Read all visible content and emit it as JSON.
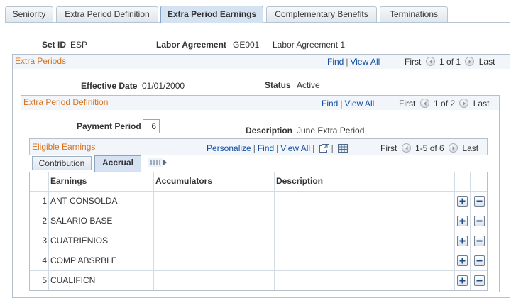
{
  "page_tabs": [
    {
      "label": "Seniority",
      "active": false
    },
    {
      "label": "Extra Period Definition",
      "active": false
    },
    {
      "label": "Extra Period Earnings",
      "active": true
    },
    {
      "label": "Complementary Benefits",
      "active": false
    },
    {
      "label": "Terminations",
      "active": false
    }
  ],
  "header": {
    "setid_label": "Set ID",
    "setid_value": "ESP",
    "labor_label": "Labor Agreement",
    "labor_code": "GE001",
    "labor_desc": "Labor Agreement 1"
  },
  "extra_periods": {
    "title": "Extra Periods",
    "find": "Find",
    "view_all": "View All",
    "first": "First",
    "count": "1 of 1",
    "last": "Last",
    "effdt_label": "Effective Date",
    "effdt_value": "01/01/2000",
    "status_label": "Status",
    "status_value": "Active"
  },
  "extra_period_definition": {
    "title": "Extra Period Definition",
    "find": "Find",
    "view_all": "View All",
    "first": "First",
    "count": "1 of 2",
    "last": "Last",
    "payment_label": "Payment Period",
    "payment_value": "6",
    "desc_label": "Description",
    "desc_value": "June Extra Period"
  },
  "eligible_earnings": {
    "title": "Eligible Earnings",
    "personalize": "Personalize",
    "find": "Find",
    "view_all": "View All",
    "first": "First",
    "count": "1-5 of 6",
    "last": "Last",
    "tabs": [
      {
        "label": "Contribution",
        "active": false
      },
      {
        "label": "Accrual",
        "active": true
      }
    ],
    "columns": [
      "Earnings",
      "Accumulators",
      "Description"
    ],
    "rows": [
      {
        "num": "1",
        "earnings": "ANT CONSOLDA",
        "accumulators": "",
        "description": ""
      },
      {
        "num": "2",
        "earnings": "SALARIO BASE",
        "accumulators": "",
        "description": ""
      },
      {
        "num": "3",
        "earnings": "CUATRIENIOS",
        "accumulators": "",
        "description": ""
      },
      {
        "num": "4",
        "earnings": "COMP ABSRBLE",
        "accumulators": "",
        "description": ""
      },
      {
        "num": "5",
        "earnings": "CUALIFICN",
        "accumulators": "",
        "description": ""
      }
    ]
  },
  "colors": {
    "link": "#114fa5",
    "group_title": "#d8731e",
    "tab_active": "#d5e2f1",
    "border": "#b5c0cc"
  }
}
